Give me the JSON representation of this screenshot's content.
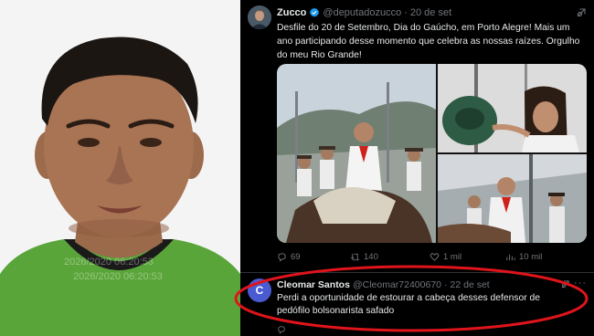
{
  "photo": {
    "watermark_text": "2026/2020 06:20:53"
  },
  "tweet": {
    "author_name": "Zucco",
    "author_handle": "@deputadozucco",
    "separator": "·",
    "date": "20 de set",
    "text": "Desfile do 20 de Setembro, Dia do Gaúcho, em Porto Alegre! Mais um ano participando desse momento que celebra as nossas raízes. Orgulho do meu Rio Grande!",
    "stats": {
      "replies": "69",
      "reposts": "140",
      "likes": "1 mil",
      "views": "10 mil"
    }
  },
  "reply": {
    "avatar_letter": "C",
    "author_name": "Cleomar Santos",
    "author_handle": "@Cleomar72400670",
    "separator": "·",
    "date": "22 de set",
    "text": "Perdi a oportunidade de estourar a cabeça desses defensor de pedófilo bolsonarista safado"
  },
  "colors": {
    "background": "#000000",
    "text": "#e7e9ea",
    "muted": "#71767b",
    "verified": "#1d9bf0",
    "annotation": "#e0141b",
    "shirt": "#5aa53a"
  },
  "icons": [
    "verified-badge-icon",
    "grok-icon",
    "reply-icon",
    "repost-icon",
    "like-icon",
    "views-icon",
    "more-icon"
  ]
}
